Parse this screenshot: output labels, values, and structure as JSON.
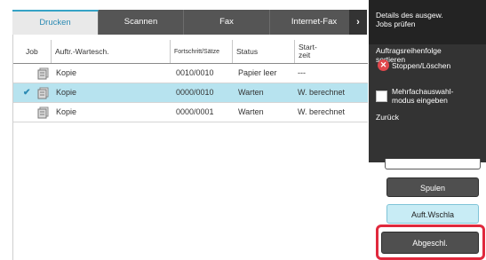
{
  "tabs": [
    {
      "label": "Drucken",
      "active": true
    },
    {
      "label": "Scannen",
      "active": false
    },
    {
      "label": "Fax",
      "active": false
    },
    {
      "label": "Internet-Fax",
      "active": false
    }
  ],
  "table": {
    "headers": {
      "job": "Job",
      "queue": "Auftr.-Wartesch.",
      "progress": "Fortschritt/Sätze",
      "status": "Status",
      "start": "Start-\nzeit"
    },
    "rows": [
      {
        "name": "Kopie",
        "progress": "0010/0010",
        "status": "Papier leer",
        "start": "---",
        "selected": false
      },
      {
        "name": "Kopie",
        "progress": "0000/0010",
        "status": "Warten",
        "start": "W. berechnet",
        "selected": true
      },
      {
        "name": "Kopie",
        "progress": "0000/0001",
        "status": "Warten",
        "start": "W. berechnet",
        "selected": false
      }
    ]
  },
  "menu": {
    "details": "Details des ausgew.\nJobs prüfen",
    "sort": "Auftragsreihenfolge\nsortieren",
    "stop": "Stoppen/Löschen",
    "multi": "Mehrfachauswahl-\nmodus eingeben",
    "back": "Zurück"
  },
  "buttons": {
    "spool": "Spulen",
    "queue": "Auft.Wschla",
    "completed": "Abgeschl."
  },
  "colors": {
    "accent": "#36a3c6",
    "selected_row": "#b7e3ef",
    "highlight_frame": "#e0293d",
    "stop_icon": "#e0474c"
  }
}
